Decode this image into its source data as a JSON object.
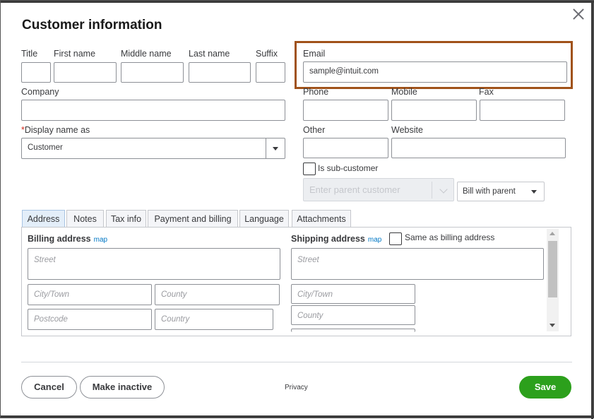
{
  "dialog": {
    "title": "Customer information"
  },
  "name_fields": {
    "title_label": "Title",
    "first_label": "First name",
    "middle_label": "Middle name",
    "last_label": "Last name",
    "suffix_label": "Suffix"
  },
  "email": {
    "label": "Email",
    "value": "sample@intuit.com"
  },
  "company": {
    "label": "Company"
  },
  "phones": {
    "phone_label": "Phone",
    "mobile_label": "Mobile",
    "fax_label": "Fax"
  },
  "display_name": {
    "required_mark": "*",
    "label": "Display name as",
    "value": "Customer"
  },
  "other": {
    "other_label": "Other",
    "website_label": "Website"
  },
  "sub_customer": {
    "label": "Is sub-customer",
    "parent_placeholder": "Enter parent customer",
    "bill_with": "Bill with parent"
  },
  "tabs": [
    {
      "label": "Address"
    },
    {
      "label": "Notes"
    },
    {
      "label": "Tax info"
    },
    {
      "label": "Payment and billing"
    },
    {
      "label": "Language"
    },
    {
      "label": "Attachments"
    }
  ],
  "billing": {
    "heading": "Billing address",
    "map": "map",
    "street_ph": "Street",
    "city_ph": "City/Town",
    "county_ph": "County",
    "postcode_ph": "Postcode",
    "country_ph": "Country"
  },
  "shipping": {
    "heading": "Shipping address",
    "map": "map",
    "same_label": "Same as billing address",
    "street_ph": "Street",
    "city_ph": "City/Town",
    "county_ph": "County"
  },
  "footer": {
    "cancel": "Cancel",
    "make_inactive": "Make inactive",
    "privacy": "Privacy",
    "save": "Save"
  },
  "colors": {
    "save_green": "#2ca01c",
    "highlight": "#a0521a",
    "link": "#0077c5"
  }
}
